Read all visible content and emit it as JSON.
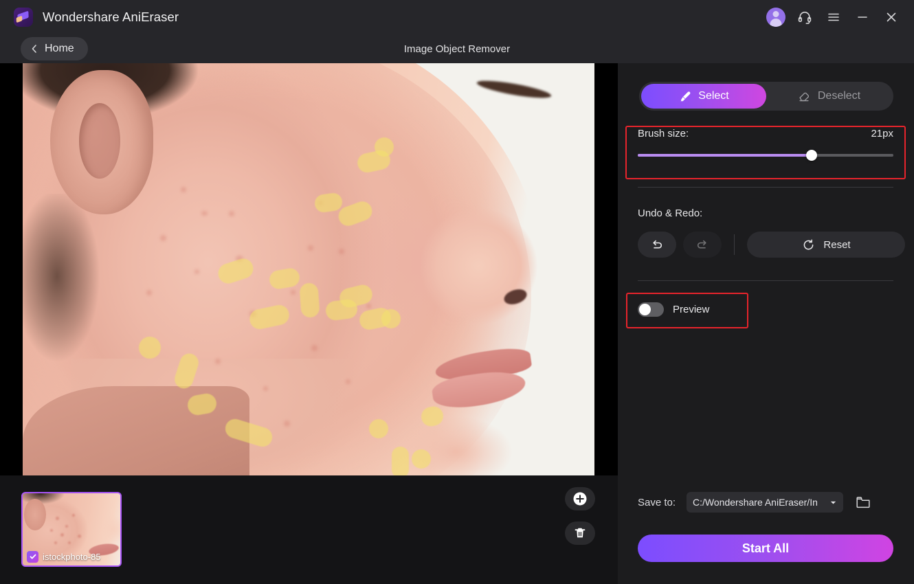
{
  "titlebar": {
    "app_title": "Wondershare AniEraser",
    "logo_icon": "eraser-logo-icon",
    "account_icon": "user-avatar-icon",
    "support_icon": "headset-icon",
    "menu_icon": "hamburger-menu-icon",
    "minimize_icon": "minimize-icon",
    "close_icon": "close-icon"
  },
  "subheader": {
    "home_label": "Home",
    "back_icon": "chevron-left-icon",
    "page_title": "Image Object Remover"
  },
  "panel": {
    "tabs": [
      {
        "label": "Select",
        "icon": "brush-icon",
        "active": true
      },
      {
        "label": "Deselect",
        "icon": "eraser-icon",
        "active": false
      }
    ],
    "brush": {
      "label": "Brush size:",
      "value_text": "21px",
      "value": 21,
      "percent": 68
    },
    "undo_redo": {
      "label": "Undo & Redo:",
      "undo_icon": "undo-arrow-icon",
      "redo_icon": "redo-arrow-icon",
      "undo_enabled": true,
      "redo_enabled": false,
      "reset_label": "Reset",
      "reset_icon": "refresh-circle-icon"
    },
    "preview": {
      "label": "Preview",
      "enabled": false
    },
    "save": {
      "label": "Save to:",
      "path": "C:/Wondershare AniEraser/In",
      "dropdown_icon": "chevron-down-icon",
      "folder_icon": "folder-icon"
    },
    "start_button": {
      "label": "Start All"
    }
  },
  "thumbbar": {
    "thumbnail": {
      "filename": "istockphoto-85",
      "selected": true,
      "check_icon": "checkmark-icon"
    },
    "add_icon": "plus-circle-icon",
    "delete_icon": "trash-icon"
  },
  "colors": {
    "accent_start": "#7c4dff",
    "accent_end": "#d044e2",
    "slider_fill": "#b98cf0",
    "highlight_box": "#e8242c",
    "brush_mask": "rgba(242,225,110,0.62)",
    "panel_bg": "#1c1c1e",
    "titlebar_bg": "#26262a",
    "canvas_bg": "#000000"
  }
}
